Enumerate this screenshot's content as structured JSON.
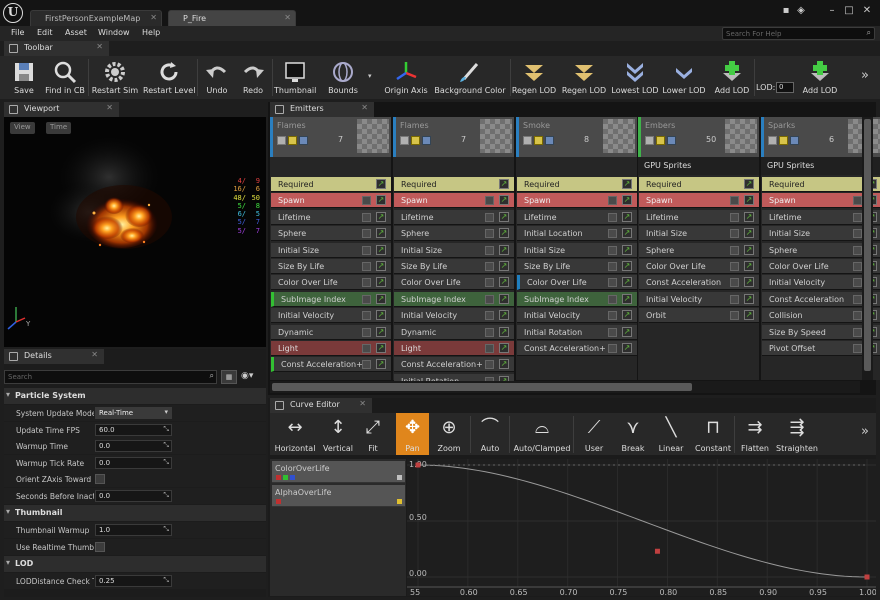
{
  "tabs": [
    {
      "label": "FirstPersonExampleMap"
    },
    {
      "label": "P_Fire"
    }
  ],
  "menu": [
    "File",
    "Edit",
    "Asset",
    "Window",
    "Help"
  ],
  "help_search": {
    "placeholder": "Search For Help"
  },
  "toolbar": {
    "title": "Toolbar",
    "buttons": [
      {
        "label": "Save",
        "icon": "save-icon"
      },
      {
        "label": "Find in CB",
        "icon": "magnifier-icon"
      },
      {
        "label": "Restart Sim",
        "icon": "gear-icon"
      },
      {
        "label": "Restart Level",
        "icon": "refresh-icon"
      },
      {
        "label": "Undo",
        "icon": "undo-icon"
      },
      {
        "label": "Redo",
        "icon": "redo-icon"
      },
      {
        "label": "Thumbnail",
        "icon": "monitor-icon"
      },
      {
        "label": "Bounds",
        "icon": "bounds-icon"
      },
      {
        "label": "Origin Axis",
        "icon": "axis-icon"
      },
      {
        "label": "Background Color",
        "icon": "brush-icon"
      },
      {
        "label": "Regen LOD",
        "icon": "regen-lod-icon"
      },
      {
        "label": "Regen LOD",
        "icon": "regen-lod-icon"
      },
      {
        "label": "Lowest LOD",
        "icon": "lowest-lod-icon"
      },
      {
        "label": "Lower LOD",
        "icon": "lower-lod-icon"
      },
      {
        "label": "Add LOD",
        "icon": "add-lod-icon"
      },
      {
        "label": "Add LOD",
        "icon": "add-lod-icon"
      }
    ],
    "lod_label": "LOD:",
    "lod_value": "0"
  },
  "viewport": {
    "title": "Viewport",
    "view_btn": "View",
    "time_btn": "Time",
    "stats": [
      {
        "l": "4/",
        "r": "9",
        "c": "#e04040"
      },
      {
        "l": "16/",
        "r": "6",
        "c": "#e0a040"
      },
      {
        "l": "48/",
        "r": "50",
        "c": "#e0e040"
      },
      {
        "l": "5/",
        "r": "8",
        "c": "#40e040"
      },
      {
        "l": "6/",
        "r": "5",
        "c": "#40c0e0"
      },
      {
        "l": "5/",
        "r": "7",
        "c": "#4060e0"
      },
      {
        "l": "5/",
        "r": "7",
        "c": "#a040e0"
      }
    ],
    "axis_y": "Y"
  },
  "details": {
    "title": "Details",
    "search_placeholder": "Search",
    "sections": [
      {
        "name": "Particle System",
        "rows": [
          {
            "label": "System Update Mode",
            "type": "dropdown",
            "value": "Real-Time"
          },
          {
            "label": "Update Time FPS",
            "type": "number",
            "value": "60.0"
          },
          {
            "label": "Warmup Time",
            "type": "number",
            "value": "0.0"
          },
          {
            "label": "Warmup Tick Rate",
            "type": "number",
            "value": "0.0"
          },
          {
            "label": "Orient ZAxis Toward C",
            "type": "check",
            "value": ""
          },
          {
            "label": "Seconds Before Inact",
            "type": "number",
            "value": "0.0"
          }
        ]
      },
      {
        "name": "Thumbnail",
        "rows": [
          {
            "label": "Thumbnail Warmup",
            "type": "number",
            "value": "1.0"
          },
          {
            "label": "Use Realtime Thumbn",
            "type": "check",
            "value": ""
          }
        ]
      },
      {
        "name": "LOD",
        "rows": [
          {
            "label": "LODDistance Check T",
            "type": "number",
            "value": "0.25"
          }
        ]
      }
    ]
  },
  "emitters": {
    "title": "Emitters",
    "columns": [
      {
        "name": "Flames",
        "count": "7",
        "stripe": "#2a7fc0",
        "gpu": "",
        "modules": [
          {
            "t": "Required",
            "k": "req"
          },
          {
            "t": "Spawn",
            "k": "spawn"
          },
          {
            "t": "Lifetime",
            "k": "norm"
          },
          {
            "t": "Sphere",
            "k": "norm"
          },
          {
            "t": "Initial Size",
            "k": "norm"
          },
          {
            "t": "Size By Life",
            "k": "norm"
          },
          {
            "t": "Color Over Life",
            "k": "norm"
          },
          {
            "t": "SubImage Index",
            "k": "sub"
          },
          {
            "t": "Initial Velocity",
            "k": "norm"
          },
          {
            "t": "Dynamic",
            "k": "norm"
          },
          {
            "t": "Light",
            "k": "light"
          },
          {
            "t": "Const Acceleration+",
            "k": "norm"
          }
        ]
      },
      {
        "name": "Flames",
        "count": "7",
        "stripe": "#2a7fc0",
        "gpu": "",
        "modules": [
          {
            "t": "Required",
            "k": "req"
          },
          {
            "t": "Spawn",
            "k": "spawn"
          },
          {
            "t": "Lifetime",
            "k": "norm"
          },
          {
            "t": "Sphere",
            "k": "norm"
          },
          {
            "t": "Initial Size",
            "k": "norm"
          },
          {
            "t": "Size By Life",
            "k": "norm"
          },
          {
            "t": "Color Over Life",
            "k": "norm"
          },
          {
            "t": "SubImage Index",
            "k": "sub"
          },
          {
            "t": "Initial Velocity",
            "k": "norm"
          },
          {
            "t": "Dynamic",
            "k": "norm"
          },
          {
            "t": "Light",
            "k": "light"
          },
          {
            "t": "Const Acceleration+",
            "k": "norm"
          },
          {
            "t": "Initial Rotation",
            "k": "norm"
          }
        ]
      },
      {
        "name": "Smoke",
        "count": "8",
        "stripe": "#2a7fc0",
        "gpu": "",
        "modules": [
          {
            "t": "Required",
            "k": "req"
          },
          {
            "t": "Spawn",
            "k": "spawn"
          },
          {
            "t": "Lifetime",
            "k": "norm"
          },
          {
            "t": "Initial Location",
            "k": "norm"
          },
          {
            "t": "Initial Size",
            "k": "norm"
          },
          {
            "t": "Size By Life",
            "k": "norm"
          },
          {
            "t": "Color Over Life",
            "k": "norm"
          },
          {
            "t": "SubImage Index",
            "k": "sub"
          },
          {
            "t": "Initial Velocity",
            "k": "norm"
          },
          {
            "t": "Initial Rotation",
            "k": "norm"
          },
          {
            "t": "Const Acceleration+",
            "k": "norm"
          }
        ]
      },
      {
        "name": "Embers",
        "count": "50",
        "stripe": "#3fb34a",
        "gpu": "GPU Sprites",
        "modules": [
          {
            "t": "Required",
            "k": "req"
          },
          {
            "t": "Spawn",
            "k": "spawn"
          },
          {
            "t": "Lifetime",
            "k": "norm"
          },
          {
            "t": "Initial Size",
            "k": "norm"
          },
          {
            "t": "Sphere",
            "k": "norm"
          },
          {
            "t": "Color Over Life",
            "k": "norm"
          },
          {
            "t": "Const Acceleration",
            "k": "norm"
          },
          {
            "t": "Initial Velocity",
            "k": "norm"
          },
          {
            "t": "Orbit",
            "k": "norm"
          }
        ]
      },
      {
        "name": "Sparks",
        "count": "6",
        "stripe": "#2a7fc0",
        "gpu": "GPU Sprites",
        "modules": [
          {
            "t": "Required",
            "k": "req"
          },
          {
            "t": "Spawn",
            "k": "spawn"
          },
          {
            "t": "Lifetime",
            "k": "norm"
          },
          {
            "t": "Initial Size",
            "k": "norm"
          },
          {
            "t": "Sphere",
            "k": "norm"
          },
          {
            "t": "Color Over Life",
            "k": "norm"
          },
          {
            "t": "Initial Velocity",
            "k": "norm"
          },
          {
            "t": "Const Acceleration",
            "k": "norm"
          },
          {
            "t": "Collision",
            "k": "norm"
          },
          {
            "t": "Size By Speed",
            "k": "norm"
          },
          {
            "t": "Pivot Offset",
            "k": "norm"
          }
        ]
      }
    ]
  },
  "curve_editor": {
    "title": "Curve Editor",
    "tools": [
      {
        "label": "Horizontal",
        "icon": "fit-horizontal-icon"
      },
      {
        "label": "Vertical",
        "icon": "fit-vertical-icon"
      },
      {
        "label": "Fit",
        "icon": "fit-icon"
      },
      {
        "label": "Pan",
        "icon": "pan-icon",
        "active": true
      },
      {
        "label": "Zoom",
        "icon": "zoom-icon"
      },
      {
        "label": "Auto",
        "icon": "auto-tangent-icon"
      },
      {
        "label": "Auto/Clamped",
        "icon": "auto-clamped-icon"
      },
      {
        "label": "User",
        "icon": "user-tangent-icon"
      },
      {
        "label": "Break",
        "icon": "break-tangent-icon"
      },
      {
        "label": "Linear",
        "icon": "linear-icon"
      },
      {
        "label": "Constant",
        "icon": "constant-icon"
      },
      {
        "label": "Flatten",
        "icon": "flatten-icon"
      },
      {
        "label": "Straighten",
        "icon": "straighten-icon"
      }
    ],
    "curves": [
      {
        "name": "ColorOverLife",
        "swatches": [
          "#c03030",
          "#30c030",
          "#3050d0"
        ],
        "end": "#c0c0c0"
      },
      {
        "name": "AlphaOverLife",
        "swatches": [
          "#c03030"
        ],
        "end": "#e0c030"
      }
    ],
    "y_labels": [
      "1.00",
      "0.50",
      "0.00"
    ],
    "x_labels": [
      "55",
      "0.60",
      "0.65",
      "0.70",
      "0.75",
      "0.80",
      "0.85",
      "0.90",
      "0.95",
      "1.00"
    ],
    "keys": [
      {
        "t": 0.55,
        "v": 1.0
      },
      {
        "t": 0.79,
        "v": 0.23
      },
      {
        "t": 1.0,
        "v": 0.0
      }
    ]
  }
}
